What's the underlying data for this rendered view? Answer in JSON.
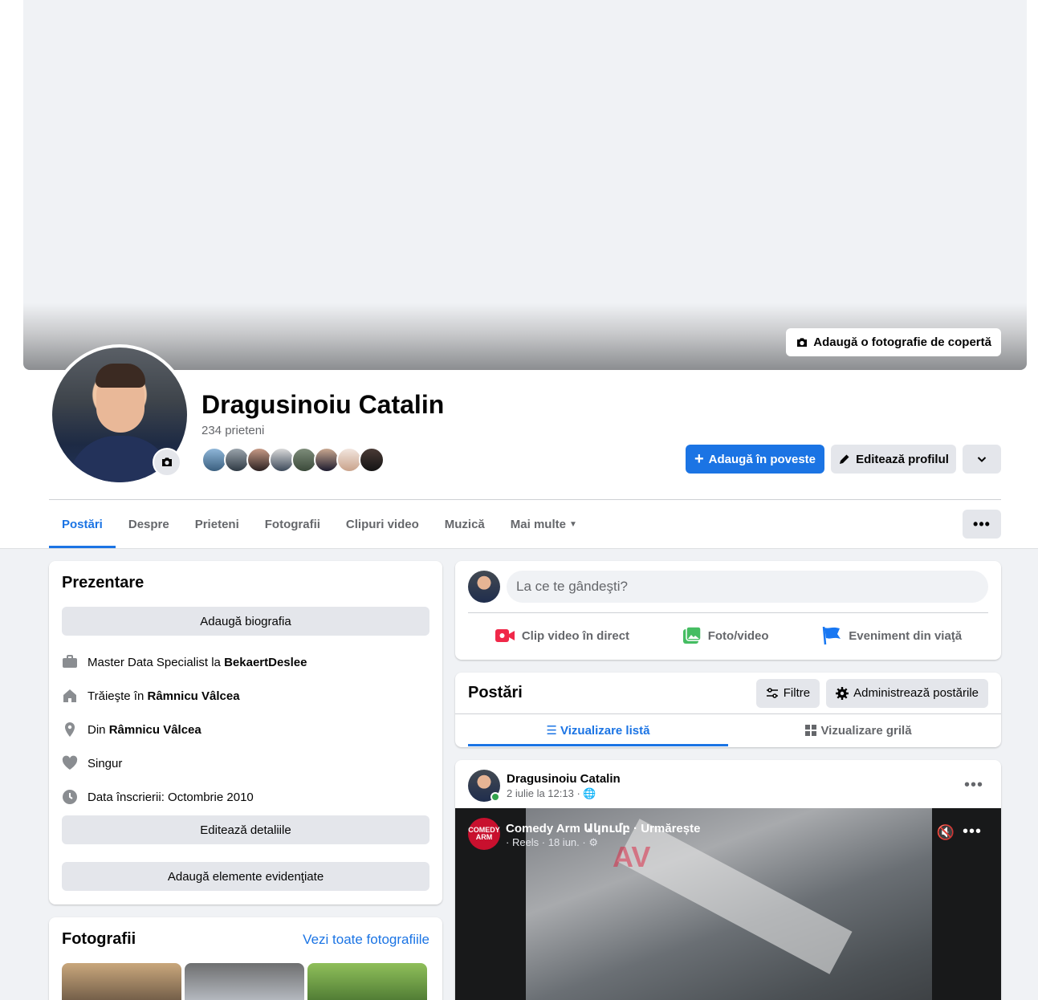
{
  "cover": {
    "add_cover_label": "Adaugă o fotografie de copertă"
  },
  "profile": {
    "name": "Dragusinoiu Catalin",
    "friends_count": "234 prieteni",
    "add_story_label": "Adaugă în poveste",
    "edit_profile_label": "Editează profilul"
  },
  "tabs": [
    {
      "label": "Postări"
    },
    {
      "label": "Despre"
    },
    {
      "label": "Prieteni"
    },
    {
      "label": "Fotografii"
    },
    {
      "label": "Clipuri video"
    },
    {
      "label": "Muzică"
    },
    {
      "label": "Mai multe"
    }
  ],
  "intro": {
    "title": "Prezentare",
    "add_bio_label": "Adaugă biografia",
    "work_prefix": "Master Data Specialist la ",
    "work_company": "BekaertDeslee",
    "lives_prefix": "Trăieşte în ",
    "lives_city": "Râmnicu Vâlcea",
    "from_prefix": "Din ",
    "from_city": "Râmnicu Vâlcea",
    "relationship": "Singur",
    "joined": "Data înscrierii: Octombrie 2010",
    "edit_details_label": "Editează detaliile",
    "add_featured_label": "Adaugă elemente evidenţiate"
  },
  "photos": {
    "title": "Fotografii",
    "see_all": "Vezi toate fotografiile"
  },
  "composer": {
    "placeholder": "La ce te gândeşti?",
    "live_label": "Clip video în direct",
    "photo_label": "Foto/video",
    "life_event_label": "Eveniment din viaţă"
  },
  "posts": {
    "title": "Postări",
    "filters_label": "Filtre",
    "manage_label": "Administrează postările",
    "list_view_label": "Vizualizare listă",
    "grid_view_label": "Vizualizare grilă"
  },
  "post": {
    "author": "Dragusinoiu Catalin",
    "time": "2 iulie la 12:13 ·",
    "video": {
      "source_title": "Comedy Arm Ակումբ · Urmărește",
      "meta": "· Reels · 18 iun. ·",
      "badge": "COMEDY ARM",
      "watermark": "AV"
    }
  },
  "colors": {
    "accent": "#1b74e4",
    "online": "#31a24c"
  }
}
